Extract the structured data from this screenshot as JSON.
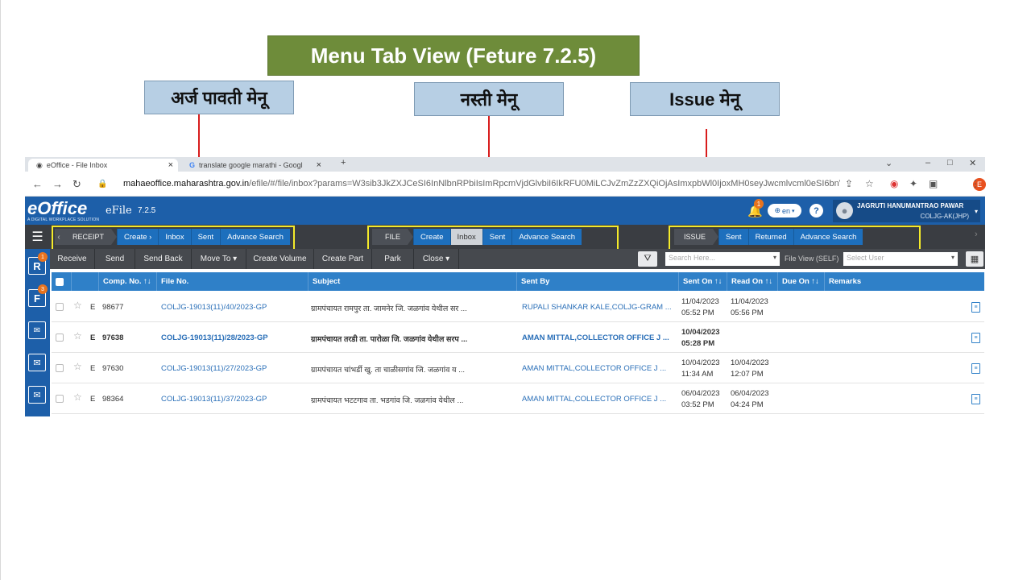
{
  "slide": {
    "title": "Menu Tab View (Feture 7.2.5)",
    "labels": {
      "receipt_menu": "अर्ज पावती मेनू",
      "file_menu": "नस्ती मेनू",
      "issue_menu": "Issue मेनू"
    }
  },
  "browser": {
    "tabs": [
      {
        "title": "eOffice - File Inbox",
        "active": true
      },
      {
        "title": "translate google marathi - Googl",
        "active": false
      }
    ],
    "url_host": "mahaeoffice.maharashtra.gov.in",
    "url_rest": "/efile/#/file/inbox?params=W3sib3JkZXJCeSI6InNlbnRPbiIsImRpcmVjdGlvbiI6IkRFU0MiLCJvZmZzZXQiOjAsImxpbWl0IjoxMH0seyJwcmlvcml0eSI6bnVsbCwi...",
    "profile_initial": "E"
  },
  "app": {
    "logo": "eOffice",
    "logo_tagline": "A DIGITAL WORKPLACE SOLUTION",
    "module": "eFile",
    "version": "7.2.5",
    "notification_count": "1",
    "language": "en",
    "help": "?",
    "user_name": "JAGRUTI HANUMANTRAO PAWAR",
    "user_role": "COLJG-AK(JHP)"
  },
  "menus": {
    "receipt": {
      "head": "RECEIPT",
      "items": [
        "Create ›",
        "Inbox",
        "Sent",
        "Advance Search"
      ]
    },
    "file": {
      "head": "FILE",
      "items": [
        "Create",
        "Inbox",
        "Sent",
        "Advance Search"
      ],
      "selected": "Inbox"
    },
    "issue": {
      "head": "ISSUE",
      "items": [
        "Sent",
        "Returned",
        "Advance Search"
      ]
    }
  },
  "toolbar": {
    "buttons": [
      "Receive",
      "Send",
      "Send Back",
      "Move To ▾",
      "Create Volume",
      "Create Part",
      "Park",
      "Close ▾"
    ],
    "search_placeholder": "Search Here...",
    "file_view_label": "File View (SELF)",
    "user_placeholder": "Select User"
  },
  "sidebar": {
    "badges": [
      "1",
      "3"
    ]
  },
  "table": {
    "headers": [
      "Comp. No. ↑↓",
      "File No.",
      "Subject",
      "Sent By",
      "Sent On ↑↓",
      "Read On ↑↓",
      "Due On ↑↓",
      "Remarks"
    ],
    "rows": [
      {
        "type": "E",
        "comp": "98677",
        "file": "COLJG-19013(11)/40/2023-GP",
        "subject": "ग्रामपंचायत रामपुर ता. जामनेर जि. जळगांव येथील सर ...",
        "sent_by": "RUPALI SHANKAR KALE,COLJG-GRAM ...",
        "sent_date": "11/04/2023",
        "sent_time": "05:52 PM",
        "read_date": "11/04/2023",
        "read_time": "05:56 PM",
        "unread": false
      },
      {
        "type": "E",
        "comp": "97638",
        "file": "COLJG-19013(11)/28/2023-GP",
        "subject": "ग्रामपंचायत तरडी ता. पारोळा जि. जळगांव येथील सरप ...",
        "sent_by": "AMAN MITTAL,COLLECTOR OFFICE J ...",
        "sent_date": "10/04/2023",
        "sent_time": "05:28 PM",
        "read_date": "",
        "read_time": "",
        "unread": true
      },
      {
        "type": "E",
        "comp": "97630",
        "file": "COLJG-19013(11)/27/2023-GP",
        "subject": "ग्रामपंचायत चांभर्डी खु. ता चाळीसगांव जि. जळगांव य ...",
        "sent_by": "AMAN MITTAL,COLLECTOR OFFICE J ...",
        "sent_date": "10/04/2023",
        "sent_time": "11:34 AM",
        "read_date": "10/04/2023",
        "read_time": "12:07 PM",
        "unread": false
      },
      {
        "type": "E",
        "comp": "98364",
        "file": "COLJG-19013(11)/37/2023-GP",
        "subject": "ग्रामपंचायत भटटगाव ता. भडगांव  जि. जळगांव येथील  ...",
        "sent_by": "AMAN MITTAL,COLLECTOR OFFICE J ...",
        "sent_date": "06/04/2023",
        "sent_time": "03:52 PM",
        "read_date": "06/04/2023",
        "read_time": "04:24 PM",
        "unread": false
      }
    ]
  },
  "colors": {
    "title_bg": "#6e8c3a",
    "label_bg": "#b7cfe4",
    "brand_blue": "#1d5fa9",
    "menu_item": "#1d6fbd",
    "highlight": "#f4ea2a",
    "arrow": "#d81c1c"
  }
}
